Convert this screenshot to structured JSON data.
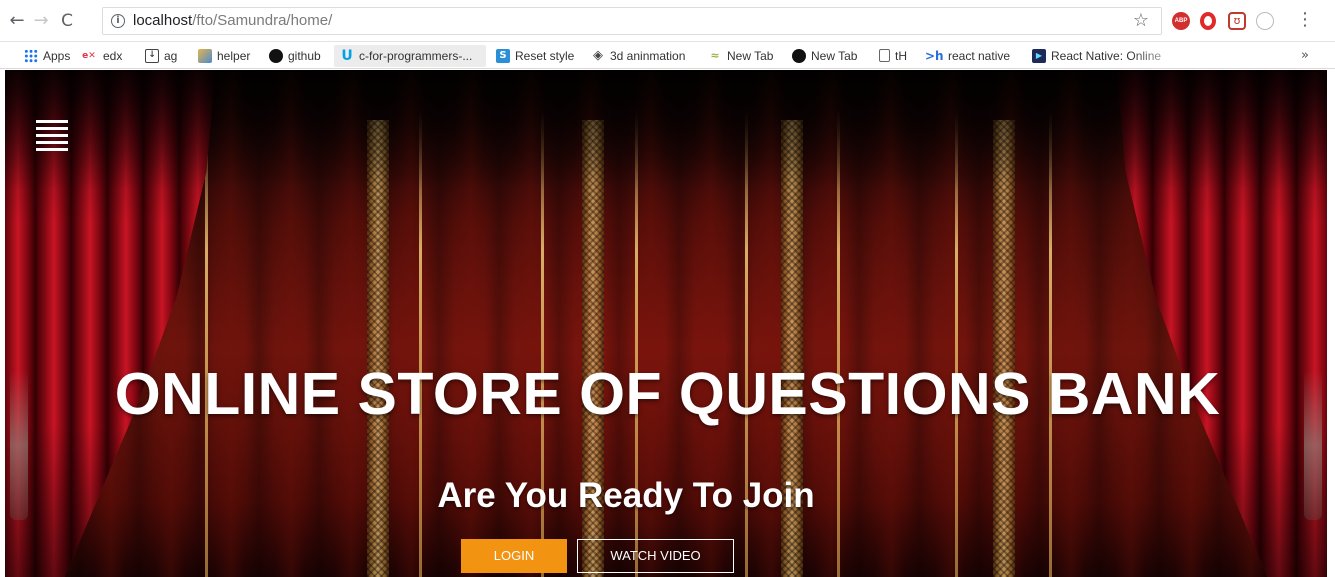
{
  "browser": {
    "url_host": "localhost",
    "url_path": "/fto/Samundra/home/"
  },
  "bookmarks": [
    {
      "label": "Apps",
      "icon": "apps-grid-icon"
    },
    {
      "label": "edx",
      "icon": "edx-icon"
    },
    {
      "label": "ag",
      "icon": "download-icon"
    },
    {
      "label": "helper",
      "icon": "image-thumbnail-icon"
    },
    {
      "label": "github",
      "icon": "github-icon"
    },
    {
      "label": "c-for-programmers-...",
      "icon": "udacity-icon"
    },
    {
      "label": "Reset style",
      "icon": "reset-style-icon"
    },
    {
      "label": "3d aninmation",
      "icon": "diamond-icon"
    },
    {
      "label": "New Tab",
      "icon": "new-tab-icon"
    },
    {
      "label": "New Tab",
      "icon": "github-icon"
    },
    {
      "label": "tH",
      "icon": "document-icon"
    },
    {
      "label": "react native",
      "icon": "hackerrank-icon"
    },
    {
      "label": "React Native: Online",
      "icon": "react-native-icon"
    }
  ],
  "bookmarks_more": "»",
  "hero": {
    "title": "ONLINE STORE OF QUESTIONS BANK",
    "subtitle": "Are You Ready To Join",
    "login_label": "LOGIN",
    "watch_video_label": "WATCH VIDEO"
  },
  "colors": {
    "login_button": "#f39312",
    "curtain_red": "#c81424",
    "stage_red": "#6a140c"
  }
}
